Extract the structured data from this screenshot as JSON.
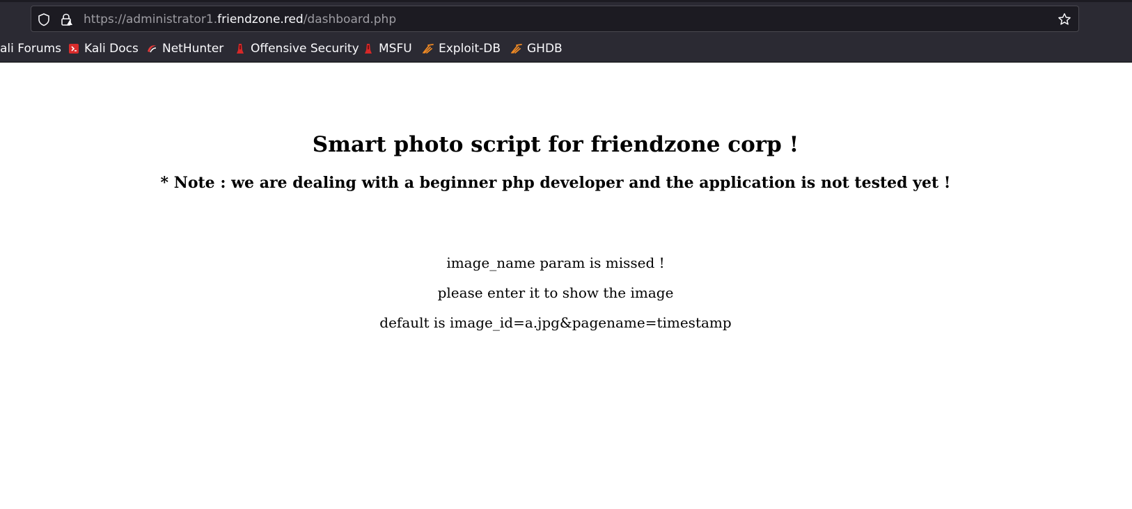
{
  "browser": {
    "url": {
      "prefix": "https://administrator1.",
      "host": "friendzone.red",
      "path": "/dashboard.php"
    },
    "bookmarks": [
      {
        "label": "ali Forums",
        "icon": "kali-icon"
      },
      {
        "label": "Kali Docs",
        "icon": "kali-docs-icon"
      },
      {
        "label": "NetHunter",
        "icon": "nethunter-icon"
      },
      {
        "label": "Offensive Security",
        "icon": "offsec-icon"
      },
      {
        "label": "MSFU",
        "icon": "offsec-icon"
      },
      {
        "label": "Exploit-DB",
        "icon": "exploitdb-icon"
      },
      {
        "label": "GHDB",
        "icon": "exploitdb-icon"
      }
    ]
  },
  "page": {
    "title": "Smart photo script for friendzone corp !",
    "note": "* Note : we are dealing with a beginner php developer and the application is not tested yet !",
    "messages": [
      "image_name param is missed !",
      "please enter it to show the image",
      "default is image_id=a.jpg&pagename=timestamp"
    ]
  }
}
